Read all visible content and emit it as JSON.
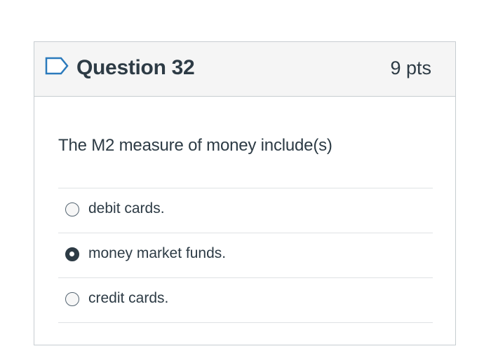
{
  "question": {
    "title": "Question 32",
    "points": "9 pts",
    "text": "The M2 measure of money include(s)",
    "answers": [
      {
        "label": "debit cards.",
        "selected": false
      },
      {
        "label": "money market funds.",
        "selected": true
      },
      {
        "label": "credit cards.",
        "selected": false
      }
    ]
  },
  "colors": {
    "text": "#2d3b45",
    "header_bg": "#f5f5f5",
    "border": "#c7cdd1",
    "flag": "#2b7abc"
  },
  "icons": {
    "flag": "flag-question-icon"
  }
}
